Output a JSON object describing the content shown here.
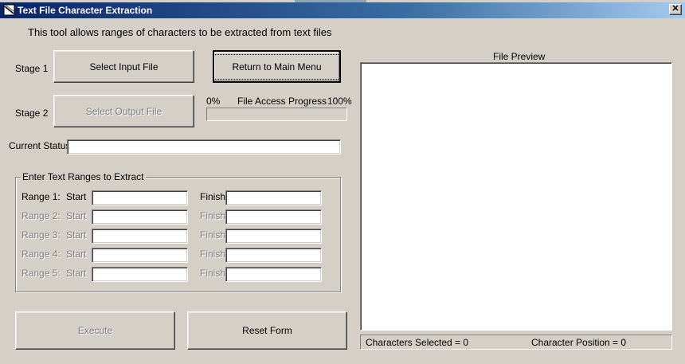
{
  "window": {
    "title": "Text File Character Extraction",
    "close_glyph": "✕"
  },
  "intro": "This tool allows ranges of characters to be extracted from text files",
  "stage1": {
    "label": "Stage 1",
    "button": "Select Input File",
    "accesskey": "I"
  },
  "stage2": {
    "label": "Stage 2",
    "button": "Select Output File",
    "accesskey": "O"
  },
  "return_button": "Return to Main Menu",
  "progress": {
    "min_label": "0%",
    "title": "File Access Progress",
    "max_label": "100%",
    "value_percent": 0
  },
  "status": {
    "label": "Current Status:",
    "value": ""
  },
  "ranges": {
    "legend": "Enter Text Ranges to Extract",
    "start_label": "Start",
    "finish_label": "Finish",
    "rows": [
      {
        "label": "Range 1:",
        "enabled": true,
        "start": "",
        "finish": ""
      },
      {
        "label": "Range 2:",
        "enabled": false,
        "start": "",
        "finish": ""
      },
      {
        "label": "Range 3:",
        "enabled": false,
        "start": "",
        "finish": ""
      },
      {
        "label": "Range 4:",
        "enabled": false,
        "start": "",
        "finish": ""
      },
      {
        "label": "Range 5:",
        "enabled": false,
        "start": "",
        "finish": ""
      }
    ]
  },
  "execute_button": "Execute",
  "reset_button": "Reset Form",
  "preview": {
    "title": "File Preview",
    "content": ""
  },
  "statusbar": {
    "characters_selected": "Characters Selected = 0",
    "character_position": "Character Position = 0"
  },
  "colors": {
    "face": "#d4d0c8",
    "titlebar_start": "#0a246a",
    "titlebar_end": "#a6caf0",
    "disabled_text": "#808080"
  }
}
